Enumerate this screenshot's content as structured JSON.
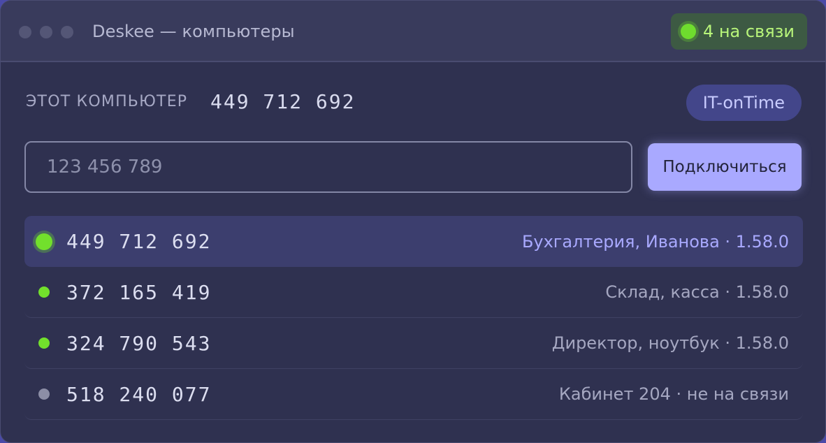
{
  "window": {
    "title": "Deskee — компьютеры",
    "online_count_label": "4 на связи"
  },
  "this_computer": {
    "label": "ЭТОТ КОМПЬЮТЕР",
    "id": "449 712 692",
    "org": "IT-onTime"
  },
  "connect": {
    "placeholder": "123 456 789",
    "value": "",
    "button_label": "Подключиться"
  },
  "computers": [
    {
      "id": "449 712 692",
      "description": "Бухгалтерия, Иванова · 1.58.0",
      "status": "online",
      "selected": true
    },
    {
      "id": "372 165 419",
      "description": "Склад, касса · 1.58.0",
      "status": "online",
      "selected": false
    },
    {
      "id": "324 790 543",
      "description": "Директор, ноутбук · 1.58.0",
      "status": "online",
      "selected": false
    },
    {
      "id": "518 240 077",
      "description": "Кабинет 204 · не на связи",
      "status": "offline",
      "selected": false
    }
  ],
  "colors": {
    "accent": "#a9a9ff",
    "online": "#72e02c",
    "offline": "#8c8ea6",
    "background": "#2f3150"
  },
  "icons": {
    "status_online": "green-dot-icon",
    "status_offline": "gray-dot-icon"
  }
}
